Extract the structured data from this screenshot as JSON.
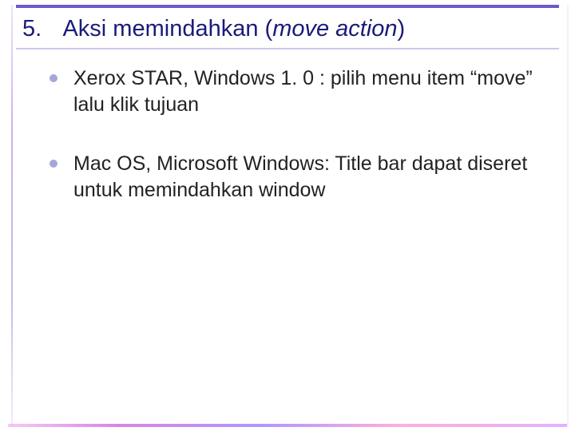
{
  "title": {
    "number": "5.",
    "plain": "Aksi memindahkan (",
    "italic": "move action",
    "after": ")"
  },
  "bullets": [
    "Xerox STAR, Windows 1. 0 : pilih menu item “move” lalu klik tujuan",
    "Mac OS, Microsoft Windows: Title bar dapat diseret untuk memindahkan window"
  ]
}
